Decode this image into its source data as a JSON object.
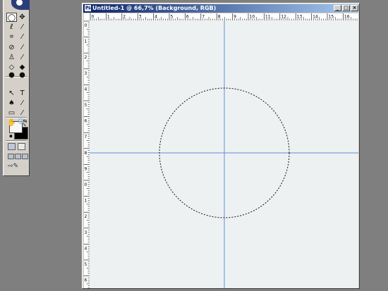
{
  "toolbox": {
    "tools": [
      {
        "id": "marquee",
        "glyph": "◯"
      },
      {
        "id": "move",
        "glyph": "✥"
      },
      {
        "id": "lasso",
        "glyph": "ℓ"
      },
      {
        "id": "magic-wand",
        "glyph": "⁄"
      },
      {
        "id": "crop",
        "glyph": "⌗"
      },
      {
        "id": "slice",
        "glyph": "⁄"
      },
      {
        "id": "healing-brush",
        "glyph": "⊘"
      },
      {
        "id": "brush",
        "glyph": "⁄"
      },
      {
        "id": "clone-stamp",
        "glyph": "♙"
      },
      {
        "id": "history-brush",
        "glyph": "⁄"
      },
      {
        "id": "eraser",
        "glyph": "◇"
      },
      {
        "id": "paint-bucket",
        "glyph": "◆"
      },
      {
        "id": "blur",
        "glyph": "●"
      },
      {
        "id": "dodge",
        "glyph": "●"
      },
      {
        "id": "path-selection",
        "glyph": "↖"
      },
      {
        "id": "type",
        "glyph": "T"
      },
      {
        "id": "pen",
        "glyph": "♠"
      },
      {
        "id": "line",
        "glyph": "⁄"
      },
      {
        "id": "notes",
        "glyph": "▭"
      },
      {
        "id": "eyedropper",
        "glyph": "⁄"
      },
      {
        "id": "hand",
        "glyph": "✋"
      },
      {
        "id": "zoom",
        "glyph": "🔍"
      }
    ],
    "swatch": {
      "foreground": "#f6f6f6",
      "background": "#000000"
    }
  },
  "document": {
    "title": "Untitled-1 @ 66,7% (Background, RGB)",
    "minimize_label": "_",
    "maximize_label": "□",
    "close_label": "×",
    "canvas_color": "#eef1f2",
    "guide_color": "#5b8fd6"
  },
  "rulers": {
    "horizontal_labels": [
      "0",
      "1",
      "2",
      "3",
      "4",
      "5",
      "6",
      "7",
      "8",
      "9",
      "10",
      "11",
      "12",
      "13",
      "14",
      "15",
      "16"
    ],
    "vertical_labels": [
      "0",
      "1",
      "2",
      "3",
      "4",
      "5",
      "6",
      "7",
      "8",
      "9",
      "0",
      "1",
      "2",
      "3",
      "4",
      "5",
      "6"
    ]
  }
}
